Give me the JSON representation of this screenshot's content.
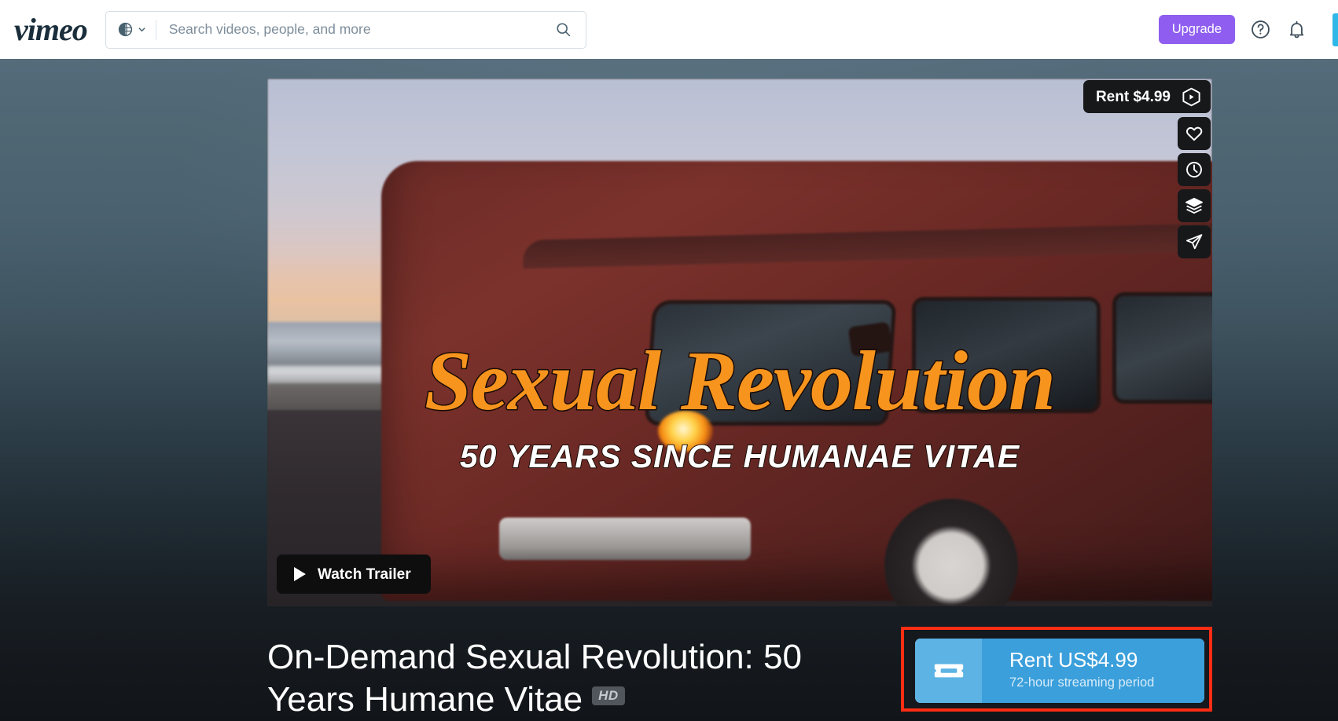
{
  "header": {
    "logo_text": "vimeo",
    "region_icon": "globe-icon",
    "region_chevron_icon": "chevron-down-icon",
    "search": {
      "placeholder": "Search videos, people, and more",
      "value": "",
      "icon": "search-icon"
    },
    "upgrade_label": "Upgrade",
    "help_icon": "help-circle-icon",
    "notifications_icon": "bell-icon",
    "avatar": "avatar"
  },
  "player": {
    "rent_pill": {
      "label": "Rent $4.99",
      "icon": "vimeo-on-demand-icon"
    },
    "side_actions": [
      {
        "name": "like-button",
        "icon": "heart-icon"
      },
      {
        "name": "watch-later-button",
        "icon": "clock-icon"
      },
      {
        "name": "add-to-collection-button",
        "icon": "layers-icon"
      },
      {
        "name": "share-button",
        "icon": "paper-plane-icon"
      }
    ],
    "watch_trailer_label": "Watch Trailer",
    "play_icon": "play-triangle-icon",
    "poster": {
      "title": "Sexual Revolution",
      "subtitle": "50 YEARS SINCE HUMANAE VITAE",
      "title_color": "#f7941e",
      "subtitle_color": "#ffffff"
    }
  },
  "video": {
    "title": "On-Demand Sexual Revolution: 50 Years Humane Vitae",
    "hd_badge": "HD"
  },
  "rent_cta": {
    "icon": "ticket-icon",
    "title": "Rent US$4.99",
    "subtitle": "72-hour streaming period",
    "button_color": "#3b9fdb",
    "icon_panel_color": "#5cb3e4",
    "highlight_color": "#ff2d13"
  },
  "colors": {
    "upgrade_purple": "#8f5ef0",
    "page_background_top": "#546c7b",
    "page_background_bottom": "#12161a",
    "header_background": "#ffffff"
  }
}
